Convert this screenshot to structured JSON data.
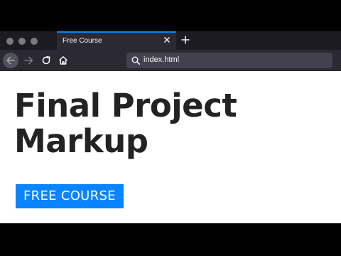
{
  "window": {
    "traffic_lights": [
      "close",
      "minimize",
      "maximize"
    ],
    "traffic_light_color": "#7a7a7e"
  },
  "tab": {
    "title": "Free Course",
    "close_icon": "close-icon",
    "new_tab_icon": "plus-icon",
    "accent_color": "#0a84ff"
  },
  "navigation": {
    "back_icon": "arrow-left-icon",
    "forward_icon": "arrow-right-icon",
    "reload_icon": "reload-icon",
    "home_icon": "home-icon"
  },
  "urlbar": {
    "icon": "search-icon",
    "value": "index.html"
  },
  "page": {
    "headline_line1": "Final Project",
    "headline_line2": "Markup",
    "badge": "FREE COURSE",
    "badge_color": "#0a84ff"
  }
}
